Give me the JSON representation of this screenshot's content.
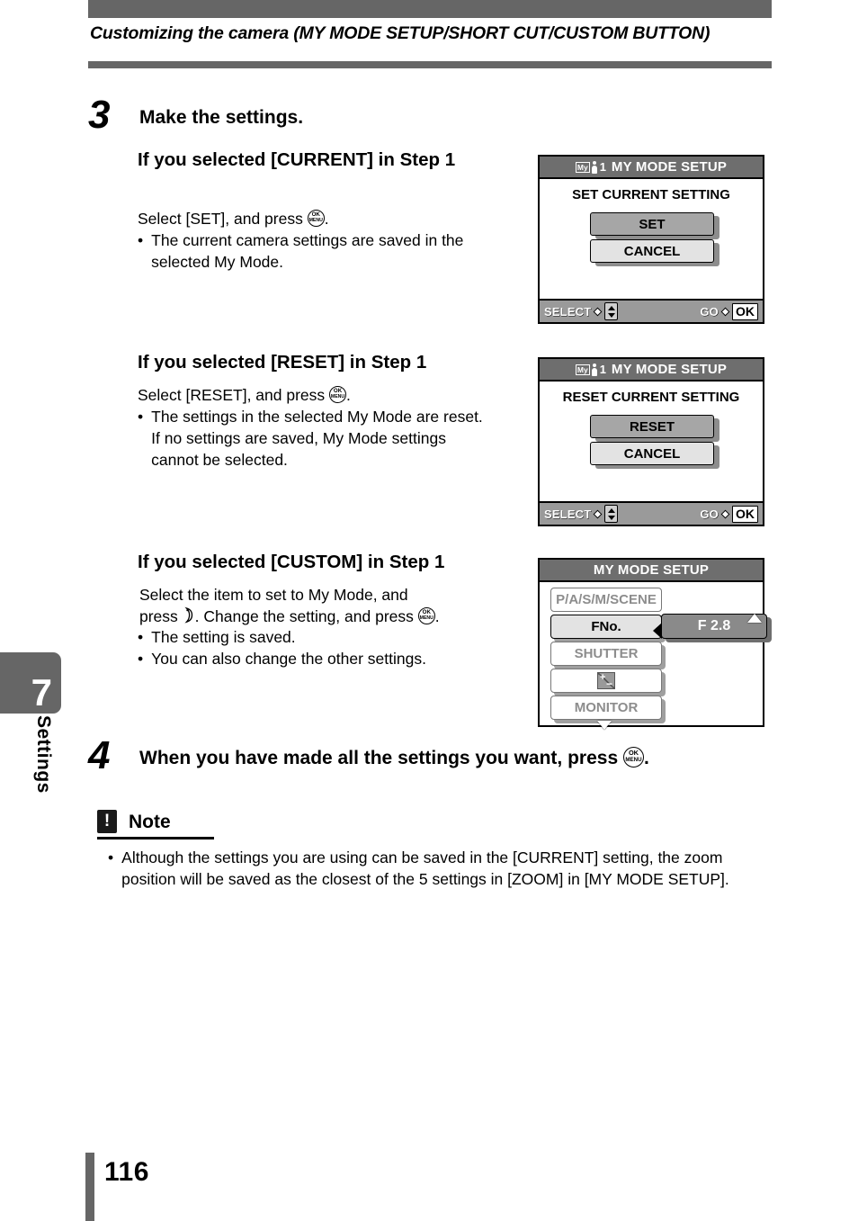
{
  "header": {
    "title": "Customizing the camera (MY MODE SETUP/SHORT CUT/CUSTOM BUTTON)"
  },
  "sidebar": {
    "chapter_number": "7",
    "chapter_label": "Settings"
  },
  "footer": {
    "page_number": "116"
  },
  "steps": [
    {
      "number": "3",
      "title": "Make the settings."
    },
    {
      "number": "4",
      "title_before_icon": "When you have made all the settings you want, press",
      "icon": "ok-menu-button-icon",
      "title_after_icon": "."
    }
  ],
  "sections": [
    {
      "heading": "If you selected [CURRENT] in Step 1",
      "instruction_before_icon": "Select [SET], and press",
      "instruction_icon": "ok-menu-button-icon",
      "instruction_after_icon": ".",
      "bullets": [
        "The current camera settings are saved in the selected My Mode."
      ]
    },
    {
      "heading": "If you selected [RESET] in Step 1",
      "instruction_before_icon": "Select [RESET], and press",
      "instruction_icon": "ok-menu-button-icon",
      "instruction_after_icon": ".",
      "bullets": [
        "The settings in the selected My Mode are reset.",
        "If no settings are saved, My Mode settings cannot be selected."
      ]
    },
    {
      "heading": "If you selected [CUSTOM] in Step 1",
      "instruction_line1": "Select the item to set to My Mode, and",
      "instruction_line2_a": "press",
      "instruction_line2_icon": "right-arrow-pad-icon",
      "instruction_line2_b": ". Change the setting, and press",
      "instruction_line2_icon2": "ok-menu-button-icon",
      "instruction_line2_c": ".",
      "bullets": [
        "The setting is saved.",
        "You can also change the other settings."
      ]
    }
  ],
  "note": {
    "icon": "exclamation-icon",
    "icon_glyph": "!",
    "label": "Note",
    "bullets": [
      "Although the settings you are using can be saved in the [CURRENT] setting, the zoom position will be saved as the closest of the 5 settings in [ZOOM] in [MY MODE SETUP]."
    ]
  },
  "screens": [
    {
      "id": "current-screen",
      "title": "MY MODE SETUP",
      "title_icon": "my-mode-1-icon",
      "caption": "SET CURRENT SETTING",
      "buttons": [
        {
          "label": "SET",
          "selected": true
        },
        {
          "label": "CANCEL",
          "selected": false
        }
      ],
      "footer_left_label": "SELECT",
      "footer_left_icon": "up-down-pad-icon",
      "footer_right_label": "GO",
      "footer_right_icon": "ok-box-icon",
      "footer_right_value": "OK"
    },
    {
      "id": "reset-screen",
      "title": "MY MODE SETUP",
      "title_icon": "my-mode-1-icon",
      "caption": "RESET CURRENT SETTING",
      "buttons": [
        {
          "label": "RESET",
          "selected": true
        },
        {
          "label": "CANCEL",
          "selected": false
        }
      ],
      "footer_left_label": "SELECT",
      "footer_left_icon": "up-down-pad-icon",
      "footer_right_label": "GO",
      "footer_right_icon": "ok-box-icon",
      "footer_right_value": "OK"
    },
    {
      "id": "custom-screen",
      "title": "MY MODE SETUP",
      "menu_items": [
        {
          "label": "P/A/S/M/SCENE",
          "active": false
        },
        {
          "label": "FNo.",
          "active": true
        },
        {
          "label": "SHUTTER",
          "active": false
        },
        {
          "label": "",
          "active": false,
          "icon": "exposure-compensation-icon"
        },
        {
          "label": "MONITOR",
          "active": false
        }
      ],
      "value": "F 2.8"
    }
  ]
}
